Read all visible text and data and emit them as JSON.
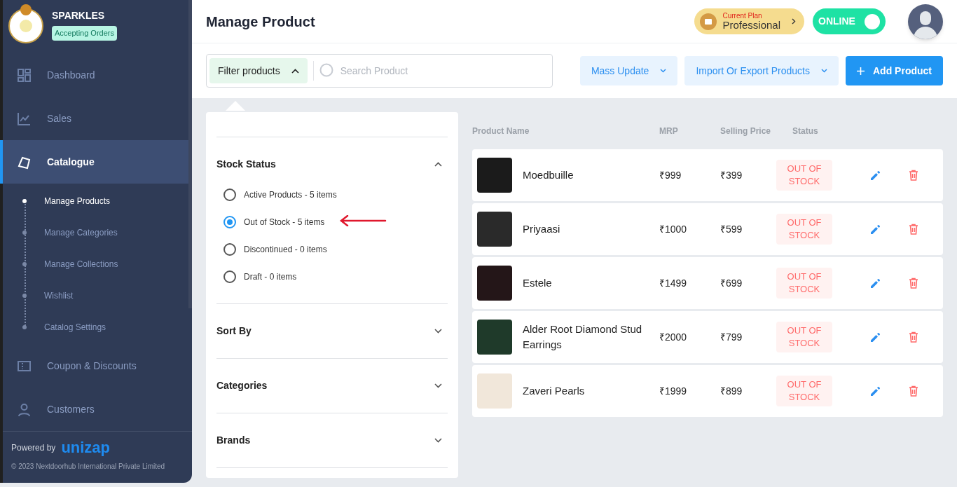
{
  "store": {
    "name": "SPARKLES",
    "badge": "Accepting Orders"
  },
  "sidebar": {
    "items": [
      {
        "label": "Dashboard",
        "selected": false
      },
      {
        "label": "Sales",
        "selected": false
      },
      {
        "label": "Catalogue",
        "selected": true,
        "children": [
          {
            "label": "Manage Products",
            "selected": true
          },
          {
            "label": "Manage Categories",
            "selected": false
          },
          {
            "label": "Manage Collections",
            "selected": false
          },
          {
            "label": "Wishlist",
            "selected": false
          },
          {
            "label": "Catalog Settings",
            "selected": false
          }
        ]
      },
      {
        "label": "Coupon & Discounts",
        "selected": false
      },
      {
        "label": "Customers",
        "selected": false
      }
    ]
  },
  "footer": {
    "powered_by": "Powered by",
    "brand": "unizap",
    "copyright": "© 2023 Nextdoorhub International Private Limited"
  },
  "header": {
    "title": "Manage Product",
    "plan_label": "Current Plan",
    "plan": "Professional",
    "online_label": "ONLINE",
    "online": true
  },
  "toolbar": {
    "filter_button": "Filter products",
    "filter_open": true,
    "search": {
      "placeholder": "Search Product"
    },
    "buttons": [
      {
        "label": "Mass Update",
        "kind": "dropdown"
      },
      {
        "label": "Import Or Export Products",
        "kind": "dropdown"
      },
      {
        "label": "Add Product",
        "kind": "primary"
      }
    ]
  },
  "filters": [
    {
      "title": "Stock Status",
      "expanded": true,
      "options": [
        {
          "label": "Active Products - 5 items",
          "selected": false
        },
        {
          "label": "Out of Stock - 5 items",
          "selected": true
        },
        {
          "label": "Discontinued - 0 items",
          "selected": false
        },
        {
          "label": "Draft - 0 items",
          "selected": false
        }
      ]
    },
    {
      "title": "Sort By",
      "expanded": false
    },
    {
      "title": "Categories",
      "expanded": false
    },
    {
      "title": "Brands",
      "expanded": false
    }
  ],
  "table": {
    "columns": [
      "Product Name",
      "MRP",
      "Selling Price",
      "Status"
    ],
    "rows": [
      {
        "name": "Moedbuille",
        "mrp": "₹999",
        "price": "₹399",
        "status": "OUT OF STOCK"
      },
      {
        "name": "Priyaasi",
        "mrp": "₹1000",
        "price": "₹599",
        "status": "OUT OF STOCK"
      },
      {
        "name": "Estele",
        "mrp": "₹1499",
        "price": "₹699",
        "status": "OUT OF STOCK"
      },
      {
        "name": "Alder Root Diamond Stud Earrings",
        "mrp": "₹2000",
        "price": "₹799",
        "status": "OUT OF STOCK"
      },
      {
        "name": "Zaveri Pearls",
        "mrp": "₹1999",
        "price": "₹899",
        "status": "OUT OF STOCK"
      }
    ]
  }
}
